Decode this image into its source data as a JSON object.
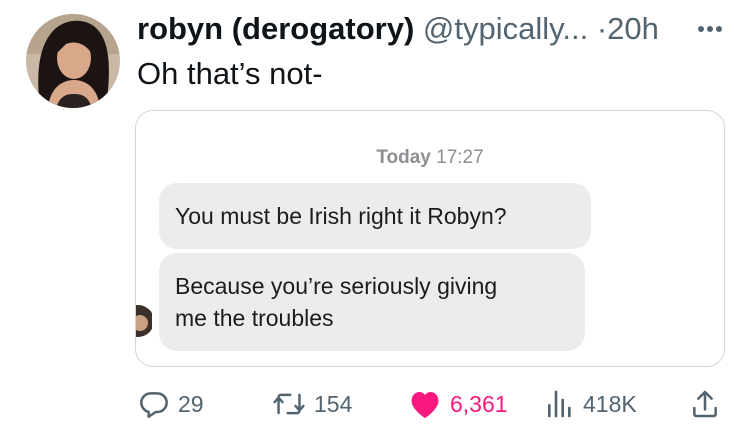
{
  "tweet": {
    "author_name": "robyn (derogatory)",
    "handle": "@typically...",
    "separator": "·",
    "time": "20h",
    "text": "Oh that’s not-"
  },
  "media": {
    "chat_day": "Today",
    "chat_time": "17:27",
    "messages": [
      {
        "lines": [
          "You must be Irish right it Robyn?"
        ]
      },
      {
        "lines": [
          "Because you’re seriously giving",
          "me the troubles"
        ]
      }
    ]
  },
  "actions": {
    "replies": "29",
    "reposts": "154",
    "likes": "6,361",
    "views": "418K"
  },
  "colors": {
    "text": "#0f1419",
    "secondary": "#536471",
    "like": "#f91880",
    "bubble": "#ececec",
    "border": "#cfd9de"
  },
  "icons": [
    "more-icon",
    "reply-icon",
    "retweet-icon",
    "heart-icon",
    "views-icon",
    "share-icon"
  ]
}
